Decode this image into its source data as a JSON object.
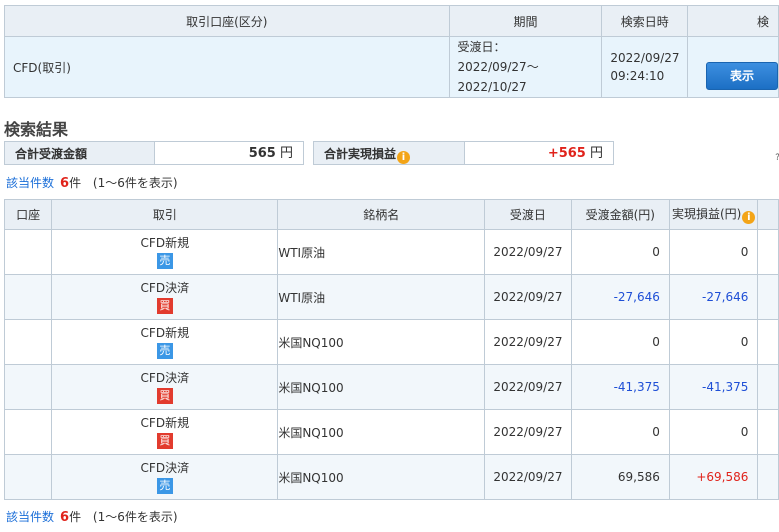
{
  "conditions": {
    "headers": {
      "account": "取引口座(区分)",
      "period": "期間",
      "search_datetime": "検索日時",
      "search_partial": "検"
    },
    "account_value": "CFD(取引)",
    "period_label": "受渡日：",
    "period_range": "2022/09/27〜2022/10/27",
    "search_date": "2022/09/27",
    "search_time": "09:24:10",
    "show_button": "表示"
  },
  "heading": "検索結果",
  "totals": {
    "delivery_label": "合計受渡金額",
    "delivery_value": "565",
    "unit": "円",
    "pnl_label": "合計実現損益",
    "pnl_value": "+565",
    "info_icon": "i",
    "edge_mark": "﹖"
  },
  "count": {
    "label": "該当件数",
    "number": "6",
    "suffix": "件",
    "range": "(1〜6件を表示)"
  },
  "results": {
    "headers": [
      "口座",
      "取引",
      "銘柄名",
      "受渡日",
      "受渡金額(円)",
      "実現損益(円)"
    ],
    "rows": [
      {
        "account": "",
        "trade": "CFD新規",
        "side": "売",
        "side_type": "sell",
        "symbol": "WTI原油",
        "date": "2022/09/27",
        "amount": "0",
        "amount_color": "normal",
        "pnl": "0",
        "pnl_color": "normal"
      },
      {
        "account": "",
        "trade": "CFD決済",
        "side": "買",
        "side_type": "buy",
        "symbol": "WTI原油",
        "date": "2022/09/27",
        "amount": "-27,646",
        "amount_color": "blue",
        "pnl": "-27,646",
        "pnl_color": "blue"
      },
      {
        "account": "",
        "trade": "CFD新規",
        "side": "売",
        "side_type": "sell",
        "symbol": "米国NQ100",
        "date": "2022/09/27",
        "amount": "0",
        "amount_color": "normal",
        "pnl": "0",
        "pnl_color": "normal"
      },
      {
        "account": "",
        "trade": "CFD決済",
        "side": "買",
        "side_type": "buy",
        "symbol": "米国NQ100",
        "date": "2022/09/27",
        "amount": "-41,375",
        "amount_color": "blue",
        "pnl": "-41,375",
        "pnl_color": "blue"
      },
      {
        "account": "",
        "trade": "CFD新規",
        "side": "買",
        "side_type": "buy",
        "symbol": "米国NQ100",
        "date": "2022/09/27",
        "amount": "0",
        "amount_color": "normal",
        "pnl": "0",
        "pnl_color": "normal"
      },
      {
        "account": "",
        "trade": "CFD決済",
        "side": "売",
        "side_type": "sell",
        "symbol": "米国NQ100",
        "date": "2022/09/27",
        "amount": "69,586",
        "amount_color": "normal",
        "pnl": "+69,586",
        "pnl_color": "red"
      }
    ]
  }
}
